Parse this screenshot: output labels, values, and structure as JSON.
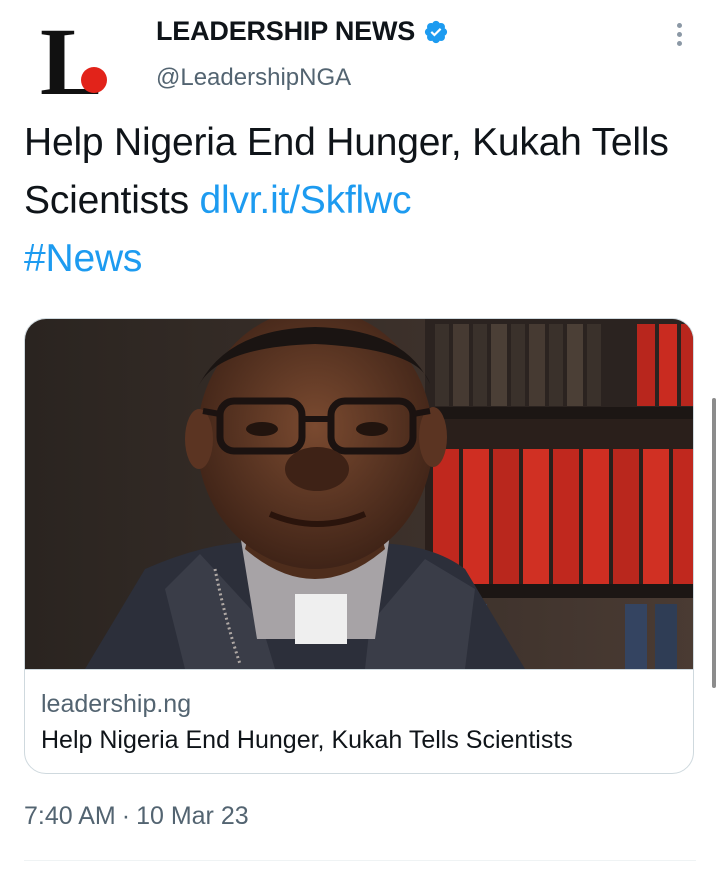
{
  "account": {
    "name": "LEADERSHIP NEWS",
    "handle": "@LeadershipNGA",
    "verified": true,
    "avatar_letter": "L",
    "avatar_dot_color": "#e2231a"
  },
  "tweet": {
    "text_plain": "Help Nigeria End Hunger, Kukah Tells Scientists",
    "link": "dlvr.it/Skflwc",
    "hashtag": "#News"
  },
  "card": {
    "domain": "leadership.ng",
    "title": "Help Nigeria End Hunger, Kukah Tells Scientists"
  },
  "meta": {
    "time": "7:40 AM",
    "separator": "·",
    "date": "10 Mar 23"
  },
  "colors": {
    "link": "#1d9bf0",
    "secondary_text": "#536471",
    "verified_badge": "#1d9bf0"
  },
  "icons": {
    "verified": "verified-badge-icon",
    "more": "more-options-icon"
  }
}
